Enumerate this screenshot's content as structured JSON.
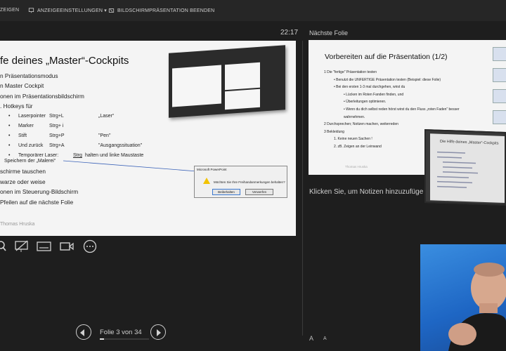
{
  "toolbar": {
    "item1": "ZEIGEN",
    "item2": "ANZEIGEEINSTELLUNGEN ▾",
    "item3": "BILDSCHIRMPRÄSENTATION BEENDEN"
  },
  "timer": "22:17",
  "next_slide_label": "Nächste Folie",
  "current_slide": {
    "title": "fe deines „Master“-Cockpits",
    "bullets": [
      "n Präsentationsmodus",
      "n Master Cockpit",
      "onen im Präsentationsbildschirm",
      ". Hotkeys für"
    ],
    "hotkeys": [
      {
        "name": "Laserpointer",
        "key": "Strg+L",
        "desc": "„Laser“"
      },
      {
        "name": "Marker",
        "key": "Strg+ i",
        "desc": ""
      },
      {
        "name": "Stift",
        "key": "Strg+P",
        "desc": "\"Pen\""
      },
      {
        "name": "Und zurück",
        "key": "Strg+A",
        "desc": "\"Ausgangssituation\""
      },
      {
        "name": "Temporärer Laser:",
        "key": "Strg",
        "desc": "halten und linke Maustaste"
      }
    ],
    "tail": [
      "Speichern der „Malerei“",
      "schirme tauschen",
      "warze oder weise",
      "onen im Steuerung-Bildschirm",
      "Pfeilen auf die nächste Folie"
    ],
    "footer": "Thomas Hruska",
    "dialog": {
      "title": "Microsoft PowerPoint",
      "message": "Möchten Sie Ihre Freihandanmerkungen behalten?",
      "keep_button": "Beibehalten",
      "discard_button": "Verwerfen"
    }
  },
  "pager": {
    "label": "Folie 3 von 34",
    "progress": 0.088
  },
  "next_slide": {
    "title": "Vorbereiten auf die Präsentation (1/2)",
    "items": [
      {
        "level": 1,
        "text": "1    Die \"fertige\" Präsentation testen"
      },
      {
        "level": 2,
        "text": "•   Benutzt die UNFERTIGE Präsentation testen (Beispiel: diese Folie)"
      },
      {
        "level": 2,
        "text": "•   Bei den ersten 1-3 mal durchgehen, wirst du"
      },
      {
        "level": 3,
        "text": "•   Lücken im Roten Fanden finden, und"
      },
      {
        "level": 3,
        "text": "•   Überleitungen optimieren."
      },
      {
        "level": 3,
        "text": "•   Wenn du dich selbst reden hörst wirst du den Fluss „roten Faden“ besser"
      },
      {
        "level": 3,
        "text": "     wahrnehmen."
      },
      {
        "level": 1,
        "text": "2    Durchsprechen; Notizen machen, weiterreden"
      },
      {
        "level": 1,
        "text": "3    Bekleidung"
      },
      {
        "level": 2,
        "text": "1.   Keine neuen Sachen !"
      },
      {
        "level": 2,
        "text": "2.   zB. Zeigen an der Leinwand"
      }
    ],
    "footer": "Thomas Hruska"
  },
  "overlay_title": "Die Hilfe deines „Master“-Cockpits",
  "notes_placeholder": "Klicken Sie, um Notizen hinzuzufüge",
  "font_controls": {
    "increase": "A",
    "decrease": "A"
  },
  "colors": {
    "background": "#1e1e1e",
    "slide": "#f4f4f4",
    "webcam_bg": "#2a7ad8"
  }
}
